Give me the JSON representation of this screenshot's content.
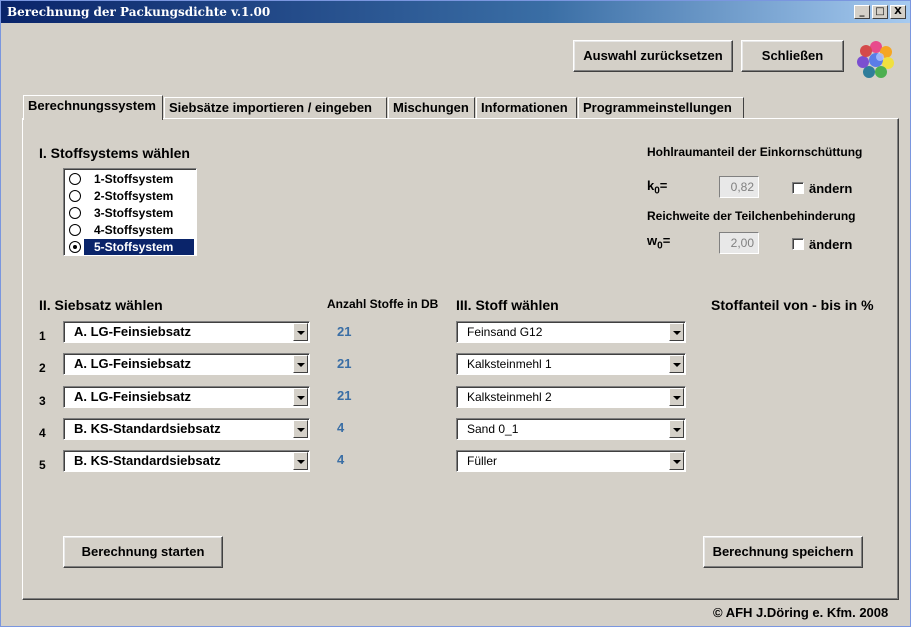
{
  "window": {
    "title": "Berechnung der Packungsdichte v.1.00",
    "controls": [
      "_",
      "□",
      "X"
    ]
  },
  "toolbar": {
    "reset_label": "Auswahl zurücksetzen",
    "close_label": "Schließen"
  },
  "tabs": [
    {
      "label": "Berechnungssystem",
      "active": true
    },
    {
      "label": "Siebsätze importieren / eingeben",
      "active": false
    },
    {
      "label": "Mischungen",
      "active": false
    },
    {
      "label": "Informationen",
      "active": false
    },
    {
      "label": "Programmeinstellungen",
      "active": false
    }
  ],
  "section1": {
    "title": "I. Stoffsystems wählen",
    "options": [
      "1-Stoffsystem",
      "2-Stoffsystem",
      "3-Stoffsystem",
      "4-Stoffsystem",
      "5-Stoffsystem"
    ],
    "selected_index": 4
  },
  "params": {
    "hohlraum_title": "Hohlraumanteil der Einkornschüttung",
    "k0_symbol": "k",
    "k0_sub": "0",
    "k0_eq": "=",
    "k0_value": "0,82",
    "k0_change_label": "ändern",
    "reichweite_title": "Reichweite der Teilchenbehinderung",
    "w0_symbol": "w",
    "w0_sub": "0",
    "w0_eq": "=",
    "w0_value": "2,00",
    "w0_change_label": "ändern"
  },
  "section2": {
    "title": "II. Siebsatz wählen",
    "count_header": "Anzahl Stoffe in DB",
    "rows": [
      {
        "num": "1",
        "siebsatz": "A. LG-Feinsiebsatz",
        "count": "21",
        "stoff": "Feinsand G12"
      },
      {
        "num": "2",
        "siebsatz": "A. LG-Feinsiebsatz",
        "count": "21",
        "stoff": "Kalksteinmehl 1"
      },
      {
        "num": "3",
        "siebsatz": "A. LG-Feinsiebsatz",
        "count": "21",
        "stoff": "Kalksteinmehl 2"
      },
      {
        "num": "4",
        "siebsatz": "B. KS-Standardsiebsatz",
        "count": "4",
        "stoff": "Sand 0_1"
      },
      {
        "num": "5",
        "siebsatz": "B. KS-Standardsiebsatz",
        "count": "4",
        "stoff": "Füller"
      }
    ]
  },
  "section3": {
    "title": "III. Stoff wählen",
    "anteil_title": "Stoffanteil von - bis in %"
  },
  "actions": {
    "start_label": "Berechnung starten",
    "save_label": "Berechnung speichern"
  },
  "footer": {
    "copyright": "©  AFH J.Döring e. Kfm. 2008"
  },
  "colors": {
    "accent": "#0a246a",
    "count_text": "#3a6ea5",
    "background": "#d4d0c8"
  }
}
